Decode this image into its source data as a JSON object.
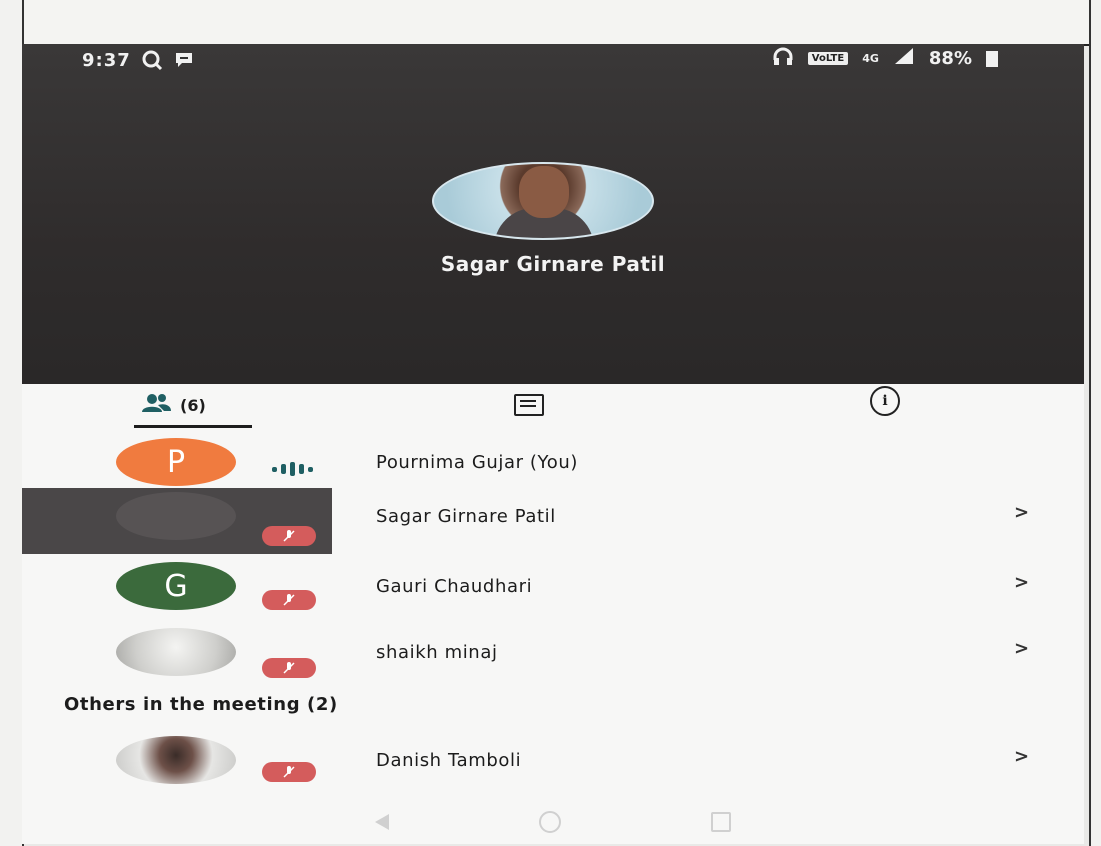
{
  "status_bar": {
    "time": "9:37",
    "volte": "VoLTE",
    "network": "4G",
    "battery": "88%"
  },
  "active_speaker": {
    "name": "Sagar Girnare Patil"
  },
  "tabs": {
    "people_count": "(6)"
  },
  "participants": [
    {
      "name": "Pournima Gujar (You)",
      "initial": "P",
      "avatar_color": "#f07b3f",
      "state": "speaking"
    },
    {
      "name": "Sagar Girnare Patil",
      "initial": "",
      "avatar_color": "#4a4748",
      "state": "muted",
      "chevron": ">"
    },
    {
      "name": "Gauri Chaudhari",
      "initial": "G",
      "avatar_color": "#3b6a3c",
      "state": "muted",
      "chevron": ">"
    },
    {
      "name": "shaikh minaj",
      "initial": "",
      "avatar_color": "#d9d9d6",
      "state": "muted",
      "chevron": ">"
    }
  ],
  "others_section": {
    "label": "Others in the meeting (2)"
  },
  "others": [
    {
      "name": "Danish Tamboli",
      "initial": "",
      "avatar_color": "#bdbdbd",
      "state": "muted",
      "chevron": ">"
    }
  ],
  "icons": {
    "search": "search-icon",
    "message": "message-icon",
    "headphones": "headphones-icon",
    "signal": "signal-icon",
    "people": "people-icon",
    "chat": "chat-icon",
    "info": "info-icon",
    "mic_off": "mic-off-icon",
    "chevron": "chevron-right-icon"
  },
  "colors": {
    "mute_badge": "#d45c5c",
    "video_bg": "#2f2c2c"
  }
}
